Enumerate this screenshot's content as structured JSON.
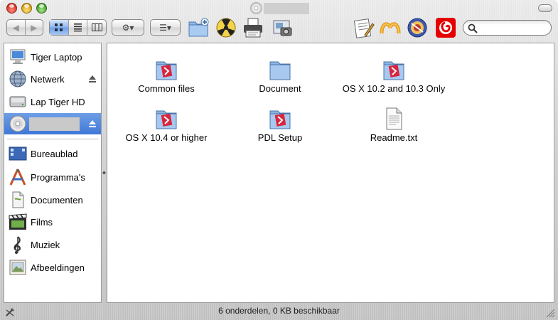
{
  "window": {
    "title_placeholder": "",
    "accent_selection": "#3f78d8"
  },
  "toolbar": {
    "back_label": "◀",
    "forward_label": "▶",
    "views": [
      "icon-view",
      "list-view",
      "column-view"
    ],
    "active_view": "icon-view",
    "action_label": "⚙▾",
    "arrange_label": "☰▾",
    "search": {
      "placeholder": "",
      "value": ""
    }
  },
  "sidebar": {
    "devices": [
      {
        "label": "Tiger Laptop",
        "icon": "imac-icon",
        "eject": false
      },
      {
        "label": "Netwerk",
        "icon": "network-globe-icon",
        "eject": true
      },
      {
        "label": "Lap Tiger HD",
        "icon": "hard-drive-icon",
        "eject": false
      },
      {
        "label": "",
        "icon": "cd-icon",
        "eject": true,
        "selected": true
      }
    ],
    "places": [
      {
        "label": "Bureaublad",
        "icon": "desktop-icon"
      },
      {
        "label": "Programma's",
        "icon": "applications-icon"
      },
      {
        "label": "Documenten",
        "icon": "documents-icon"
      },
      {
        "label": "Films",
        "icon": "movies-icon"
      },
      {
        "label": "Muziek",
        "icon": "music-icon"
      },
      {
        "label": "Afbeeldingen",
        "icon": "pictures-icon"
      }
    ]
  },
  "files": [
    {
      "name": "Common files",
      "icon": "app-folder-icon"
    },
    {
      "name": "Document",
      "icon": "folder-icon"
    },
    {
      "name": "OS X 10.2 and 10.3 Only",
      "icon": "app-folder-icon"
    },
    {
      "name": "OS X 10.4 or higher",
      "icon": "app-folder-icon"
    },
    {
      "name": "PDL Setup",
      "icon": "app-folder-icon"
    },
    {
      "name": "Readme.txt",
      "icon": "text-document-icon"
    }
  ],
  "status": {
    "text": "6 onderdelen, 0 KB beschikbaar"
  }
}
